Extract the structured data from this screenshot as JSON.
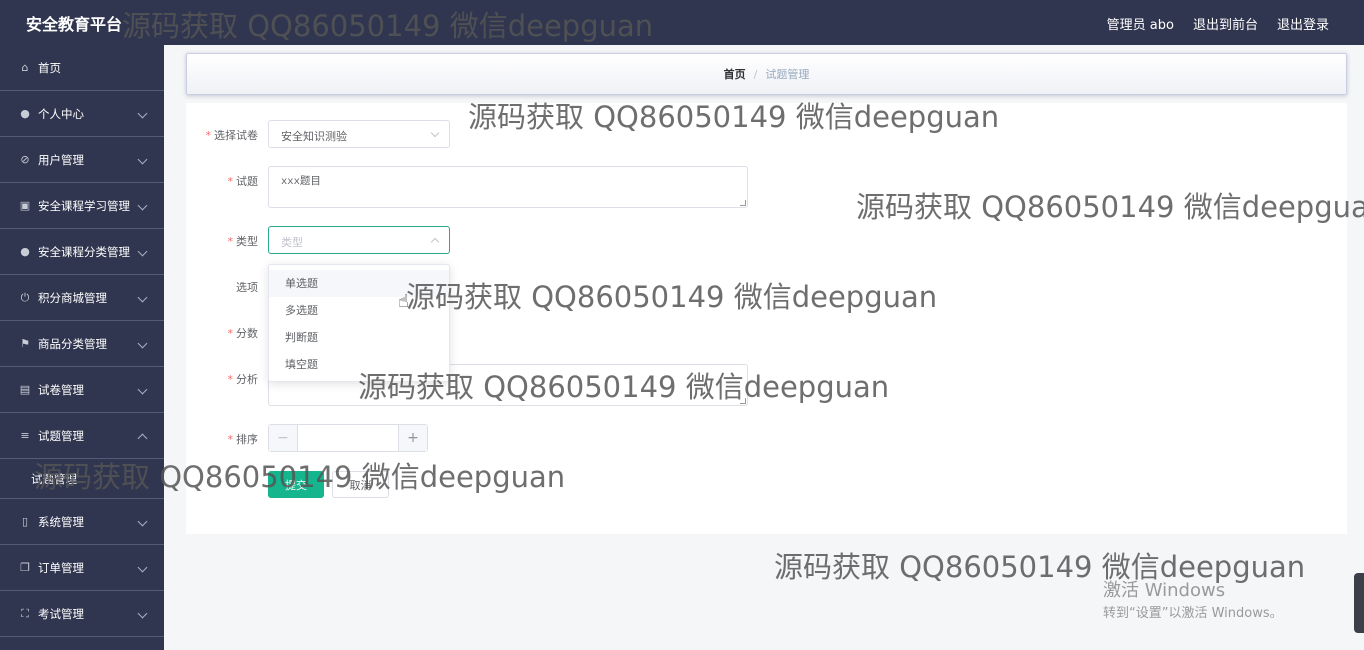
{
  "header": {
    "brand": "安全教育平台",
    "user": "管理员 abo",
    "to_front": "退出到前台",
    "logout": "退出登录"
  },
  "sidebar": {
    "items": [
      {
        "label": "首页",
        "icon": "home-icon",
        "glyph": "⌂"
      },
      {
        "label": "个人中心",
        "icon": "user-icon",
        "glyph": "●"
      },
      {
        "label": "用户管理",
        "icon": "user-manage-icon",
        "glyph": "⊘"
      },
      {
        "label": "安全课程学习管理",
        "icon": "clipboard-icon",
        "glyph": "▣"
      },
      {
        "label": "安全课程分类管理",
        "icon": "person-icon",
        "glyph": "●"
      },
      {
        "label": "积分商城管理",
        "icon": "power-icon",
        "glyph": "⏻"
      },
      {
        "label": "商品分类管理",
        "icon": "flag-icon",
        "glyph": "⚑"
      },
      {
        "label": "试卷管理",
        "icon": "briefcase-icon",
        "glyph": "▤"
      },
      {
        "label": "试题管理",
        "icon": "list-icon",
        "glyph": "≡"
      },
      {
        "label": "系统管理",
        "icon": "phone-icon",
        "glyph": "▯"
      },
      {
        "label": "订单管理",
        "icon": "copy-icon",
        "glyph": "❐"
      },
      {
        "label": "考试管理",
        "icon": "scan-icon",
        "glyph": "⛶"
      }
    ],
    "sub_label": "试题管理"
  },
  "breadcrumb": {
    "home": "首页",
    "separator": "/",
    "current": "试题管理"
  },
  "form": {
    "paper_label": "选择试卷",
    "paper_value": "安全知识测验",
    "question_label": "试题",
    "question_placeholder": "xxx题目",
    "type_label": "类型",
    "type_placeholder": "类型",
    "options_label": "选项",
    "score_label": "分数",
    "analysis_label": "分析",
    "order_label": "排序",
    "minus": "−",
    "plus": "+",
    "submit": "提交",
    "cancel": "取消",
    "required_mark": "*"
  },
  "dropdown": {
    "options": [
      "单选题",
      "多选题",
      "判断题",
      "填空题"
    ]
  },
  "watermark": "源码获取 QQ86050149 微信deepguan",
  "activation": {
    "line1": "激活 Windows",
    "line2": "转到“设置”以激活 Windows。"
  },
  "colors": {
    "sidebar_bg": "#30364f",
    "primary": "#15b68d",
    "active_border": "#2aa88a",
    "required": "#f56c6c"
  }
}
